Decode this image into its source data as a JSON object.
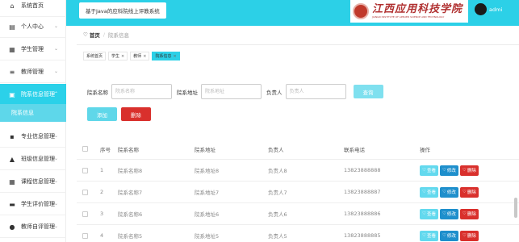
{
  "sidebar": {
    "items": [
      {
        "label": "系统首页",
        "icon": "home-icon",
        "glyph": "⌂",
        "active": false
      },
      {
        "label": "个人中心",
        "icon": "user-icon",
        "glyph": "▤",
        "active": false
      },
      {
        "label": "学生管理",
        "icon": "grid-icon",
        "glyph": "▦",
        "active": false
      },
      {
        "label": "教师管理",
        "icon": "sliders-icon",
        "glyph": "≡",
        "active": false
      },
      {
        "label": "院系信息管理",
        "icon": "doc-icon",
        "glyph": "▣",
        "active": true
      },
      {
        "label": "专业信息管理",
        "icon": "folder-icon",
        "glyph": "▪",
        "active": false
      },
      {
        "label": "班级信息管理",
        "icon": "class-icon",
        "glyph": "▲",
        "active": false
      },
      {
        "label": "课程信息管理",
        "icon": "book-icon",
        "glyph": "▦",
        "active": false
      },
      {
        "label": "学生评价管理",
        "icon": "print-icon",
        "glyph": "▬",
        "active": false
      },
      {
        "label": "教师自评管理",
        "icon": "person-icon",
        "glyph": "●",
        "active": false
      }
    ],
    "sub_item": "院系信息"
  },
  "header": {
    "system_title": "基于Java的应科院线上评教系统",
    "logo_cn": "江西应用科技学院",
    "logo_en": "JIANGXI INSTITUTE OF APPLIED SCIENCE AND TECHNOLOGY",
    "username": "admi"
  },
  "breadcrumb": {
    "home": "首页",
    "sep": "/",
    "current": "院系信息"
  },
  "tabs": [
    {
      "label": "系统首页",
      "closable": false,
      "active": false
    },
    {
      "label": "学生",
      "closable": true,
      "active": false
    },
    {
      "label": "教师",
      "closable": true,
      "active": false
    },
    {
      "label": "院系信息",
      "closable": true,
      "active": true
    }
  ],
  "search": {
    "fields": [
      {
        "label": "院系名称",
        "placeholder": "院系名称"
      },
      {
        "label": "院系地址",
        "placeholder": "院系地址"
      },
      {
        "label": "负责人",
        "placeholder": "负责人"
      }
    ],
    "query_label": "查询",
    "add_label": "添加",
    "delete_label": "删除"
  },
  "table": {
    "columns": [
      "序号",
      "院系名称",
      "院系地址",
      "负责人",
      "联系电话",
      "操作"
    ],
    "rows": [
      [
        "1",
        "院系名称8",
        "院系地址8",
        "负责人8",
        "13823888888"
      ],
      [
        "2",
        "院系名称7",
        "院系地址7",
        "负责人7",
        "13823888887"
      ],
      [
        "3",
        "院系名称6",
        "院系地址6",
        "负责人6",
        "13823888886"
      ],
      [
        "4",
        "院系名称5",
        "院系地址5",
        "负责人5",
        "13823888885"
      ]
    ],
    "ops": {
      "view": "查看",
      "edit": "修改",
      "del": "删除"
    }
  },
  "colors": {
    "accent": "#2cd0e7",
    "danger": "#d9302c",
    "edit": "#1e8fcc"
  }
}
